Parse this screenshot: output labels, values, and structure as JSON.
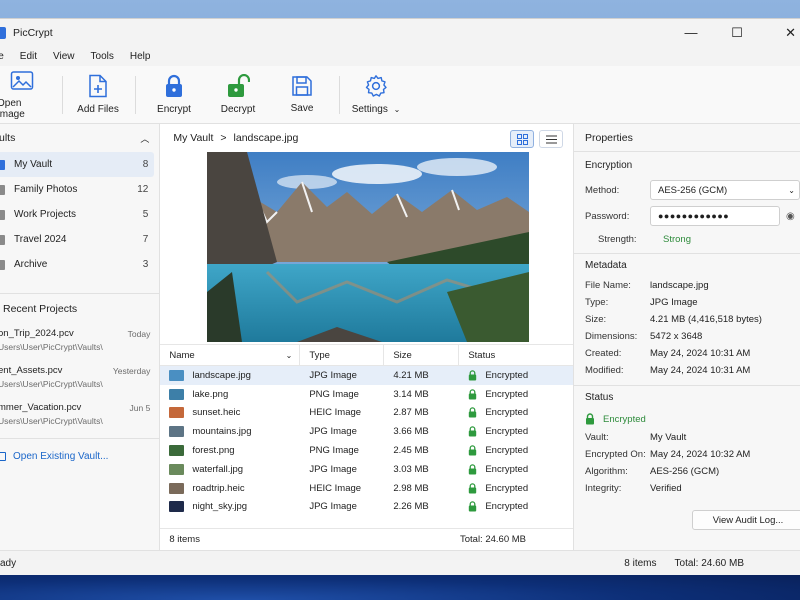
{
  "window": {
    "title": "PicCrypt",
    "minimize": "—",
    "maximize": "☐",
    "close": "✕"
  },
  "menu": [
    "le",
    "Edit",
    "View",
    "Tools",
    "Help"
  ],
  "toolbar": {
    "open_image": "Open Image",
    "add_files": "Add Files",
    "encrypt": "Encrypt",
    "decrypt": "Decrypt",
    "save": "Save",
    "settings": "Settings"
  },
  "sidebar": {
    "vaults_header": "ults",
    "vaults": [
      {
        "label": "My Vault",
        "count": "8",
        "color": "#2f6fdb"
      },
      {
        "label": "Family Photos",
        "count": "12",
        "color": "#8a8a8a"
      },
      {
        "label": "Work Projects",
        "count": "5",
        "color": "#8a8a8a"
      },
      {
        "label": "Travel 2024",
        "count": "7",
        "color": "#8a8a8a"
      },
      {
        "label": "Archive",
        "count": "3",
        "color": "#8a8a8a"
      }
    ],
    "recent_header": "Recent Projects",
    "recent": [
      {
        "name": "on_Trip_2024.pcv",
        "path": "Users\\User\\PicCrypt\\Vaults\\",
        "date": "Today"
      },
      {
        "name": "ent_Assets.pcv",
        "path": "Users\\User\\PicCrypt\\Vaults\\",
        "date": "Yesterday"
      },
      {
        "name": "mmer_Vacation.pcv",
        "path": "Users\\User\\PicCrypt\\Vaults\\",
        "date": "Jun 5"
      }
    ],
    "open_existing": "Open Existing Vault..."
  },
  "breadcrumb": {
    "root": "My Vault",
    "sep": ">",
    "current": "landscape.jpg"
  },
  "table": {
    "headers": {
      "name": "Name",
      "type": "Type",
      "size": "Size",
      "status": "Status"
    },
    "rows": [
      {
        "name": "landscape.jpg",
        "type": "JPG Image",
        "size": "4.21 MB",
        "status": "Encrypted",
        "thumb": "#4a8fc2"
      },
      {
        "name": "lake.png",
        "type": "PNG Image",
        "size": "3.14 MB",
        "status": "Encrypted",
        "thumb": "#3d7fa8"
      },
      {
        "name": "sunset.heic",
        "type": "HEIC Image",
        "size": "2.87 MB",
        "status": "Encrypted",
        "thumb": "#c4683a"
      },
      {
        "name": "mountains.jpg",
        "type": "JPG Image",
        "size": "3.66 MB",
        "status": "Encrypted",
        "thumb": "#5d7485"
      },
      {
        "name": "forest.png",
        "type": "PNG Image",
        "size": "2.45 MB",
        "status": "Encrypted",
        "thumb": "#3b6a3a"
      },
      {
        "name": "waterfall.jpg",
        "type": "JPG Image",
        "size": "3.03 MB",
        "status": "Encrypted",
        "thumb": "#6a8a5c"
      },
      {
        "name": "roadtrip.heic",
        "type": "HEIC Image",
        "size": "2.98 MB",
        "status": "Encrypted",
        "thumb": "#7a6a5a"
      },
      {
        "name": "night_sky.jpg",
        "type": "JPG Image",
        "size": "2.26 MB",
        "status": "Encrypted",
        "thumb": "#1e2a4a"
      }
    ],
    "footer_count": "8 items",
    "footer_total": "Total: 24.60 MB"
  },
  "properties": {
    "title": "Properties",
    "encryption": {
      "header": "Encryption",
      "method_label": "Method:",
      "method_value": "AES-256 (GCM)",
      "password_label": "Password:",
      "password_value": "●●●●●●●●●●●●",
      "strength_label": "Strength:",
      "strength_value": "Strong"
    },
    "metadata": {
      "header": "Metadata",
      "rows": [
        {
          "k": "File Name:",
          "v": "landscape.jpg"
        },
        {
          "k": "Type:",
          "v": "JPG Image"
        },
        {
          "k": "Size:",
          "v": "4.21 MB  (4,416,518 bytes)"
        },
        {
          "k": "Dimensions:",
          "v": "5472 x 3648"
        },
        {
          "k": "Created:",
          "v": "May 24, 2024 10:31 AM"
        },
        {
          "k": "Modified:",
          "v": "May 24, 2024 10:31 AM"
        }
      ]
    },
    "status": {
      "header": "Status",
      "state": "Encrypted",
      "rows": [
        {
          "k": "Vault:",
          "v": "My Vault"
        },
        {
          "k": "Encrypted On:",
          "v": "May 24, 2024 10:32 AM"
        },
        {
          "k": "Algorithm:",
          "v": "AES-256 (GCM)"
        },
        {
          "k": "Integrity:",
          "v": "Verified"
        }
      ],
      "audit_button": "View Audit Log..."
    }
  },
  "statusbar": {
    "state": "ady",
    "items": "8 items",
    "total": "Total: 24.60 MB"
  }
}
